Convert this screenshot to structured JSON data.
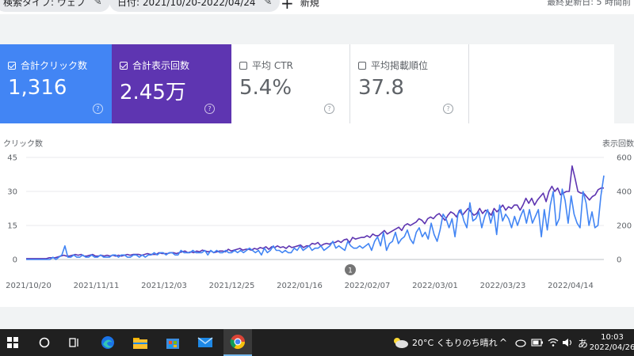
{
  "filters": {
    "search_type": "検索タイプ: ウェブ",
    "date_range": "日付: 2021/10/20-2022/04/24",
    "new_label": "新規",
    "last_updated": "最終更新日: 5 時間前"
  },
  "metrics": [
    {
      "label": "合計クリック数",
      "value": "1,316",
      "checked": true,
      "color": "#4285f4"
    },
    {
      "label": "合計表示回数",
      "value": "2.45万",
      "checked": true,
      "color": "#5e35b1"
    },
    {
      "label": "平均 CTR",
      "value": "5.4%",
      "checked": false
    },
    {
      "label": "平均掲載順位",
      "value": "37.8",
      "checked": false
    }
  ],
  "chart_labels": {
    "left_axis": "クリック数",
    "right_axis": "表示回数",
    "annotation": "1"
  },
  "chart_data": {
    "type": "line",
    "x_start": "2021/10/20",
    "x_end": "2022/04/24",
    "x_ticks": [
      "2021/10/20",
      "2021/11/11",
      "2021/12/03",
      "2021/12/25",
      "2022/01/16",
      "2022/02/07",
      "2022/03/01",
      "2022/03/23",
      "2022/04/14"
    ],
    "y_left_ticks": [
      0,
      15,
      30,
      45
    ],
    "y_right_ticks": [
      0,
      200,
      400,
      600
    ],
    "ylim_left": [
      0,
      45
    ],
    "ylim_right": [
      0,
      600
    ],
    "grid": true,
    "series": [
      {
        "name": "クリック数",
        "axis": "left",
        "color": "#4285f4",
        "values": [
          0,
          0,
          0,
          0,
          0,
          0,
          0,
          0,
          0,
          1,
          0,
          1,
          2,
          6,
          1,
          1,
          2,
          1,
          1,
          2,
          1,
          1,
          2,
          1,
          1,
          2,
          1,
          1,
          1,
          2,
          2,
          1,
          2,
          2,
          1,
          1,
          2,
          2,
          1,
          2,
          1,
          2,
          2,
          3,
          2,
          3,
          3,
          2,
          3,
          3,
          2,
          2,
          4,
          3,
          3,
          3,
          4,
          3,
          3,
          3,
          4,
          2,
          4,
          3,
          4,
          3,
          3,
          4,
          3,
          3,
          4,
          3,
          4,
          3,
          4,
          5,
          4,
          3,
          4,
          2,
          5,
          3,
          4,
          6,
          4,
          4,
          3,
          4,
          3,
          3,
          5,
          4,
          6,
          4,
          5,
          6,
          4,
          5,
          5,
          6,
          4,
          5,
          6,
          8,
          5,
          6,
          5,
          4,
          8,
          6,
          5,
          5,
          6,
          5,
          6,
          7,
          4,
          8,
          10,
          6,
          12,
          4,
          7,
          8,
          12,
          7,
          9,
          10,
          13,
          9,
          7,
          12,
          14,
          10,
          12,
          9,
          16,
          11,
          8,
          13,
          20,
          18,
          14,
          18,
          10,
          20,
          22,
          17,
          14,
          25,
          17,
          18,
          21,
          14,
          19,
          22,
          16,
          21,
          11,
          24,
          17,
          20,
          18,
          14,
          19,
          15,
          19,
          22,
          16,
          22,
          16,
          19,
          22,
          10,
          22,
          13,
          24,
          30,
          15,
          18,
          31,
          26,
          16,
          28,
          20,
          16,
          14,
          30,
          25,
          15,
          21,
          14,
          15,
          28,
          37
        ]
      },
      {
        "name": "表示回数",
        "axis": "right",
        "color": "#5e35b1",
        "values": [
          5,
          5,
          5,
          5,
          5,
          5,
          5,
          5,
          10,
          10,
          10,
          15,
          20,
          25,
          20,
          20,
          25,
          30,
          25,
          30,
          20,
          20,
          25,
          30,
          20,
          20,
          25,
          20,
          25,
          20,
          25,
          20,
          25,
          20,
          25,
          30,
          25,
          30,
          30,
          30,
          25,
          30,
          35,
          30,
          30,
          30,
          40,
          35,
          35,
          35,
          40,
          40,
          35,
          40,
          45,
          50,
          40,
          45,
          40,
          50,
          45,
          55,
          50,
          45,
          50,
          40,
          45,
          50,
          50,
          45,
          60,
          50,
          55,
          60,
          65,
          55,
          60,
          60,
          55,
          65,
          60,
          70,
          65,
          75,
          60,
          75,
          70,
          80,
          70,
          75,
          65,
          80,
          70,
          75,
          80,
          85,
          70,
          80,
          80,
          95,
          90,
          100,
          80,
          90,
          95,
          90,
          100,
          100,
          110,
          100,
          115,
          120,
          100,
          130,
          120,
          125,
          130,
          130,
          140,
          130,
          150,
          140,
          140,
          155,
          170,
          150,
          160,
          170,
          180,
          190,
          170,
          200,
          210,
          200,
          210,
          220,
          240,
          230,
          210,
          240,
          250,
          240,
          260,
          270,
          250,
          230,
          260,
          280,
          270,
          250,
          290,
          260,
          280,
          300,
          280,
          260,
          270,
          300,
          270,
          290,
          280,
          260,
          300,
          280,
          300,
          320,
          290,
          310,
          300,
          320,
          320,
          290,
          320,
          360,
          330,
          360,
          320,
          350,
          370,
          390,
          340,
          400,
          430,
          400,
          420,
          380,
          390,
          400,
          400,
          550,
          480,
          400,
          390,
          390,
          370,
          350,
          370,
          380,
          410,
          420,
          420
        ]
      }
    ]
  },
  "taskbar": {
    "weather": "20°C くもりのち晴れ",
    "time": "10:03",
    "date": "2022/04/26",
    "ime": "あ"
  }
}
